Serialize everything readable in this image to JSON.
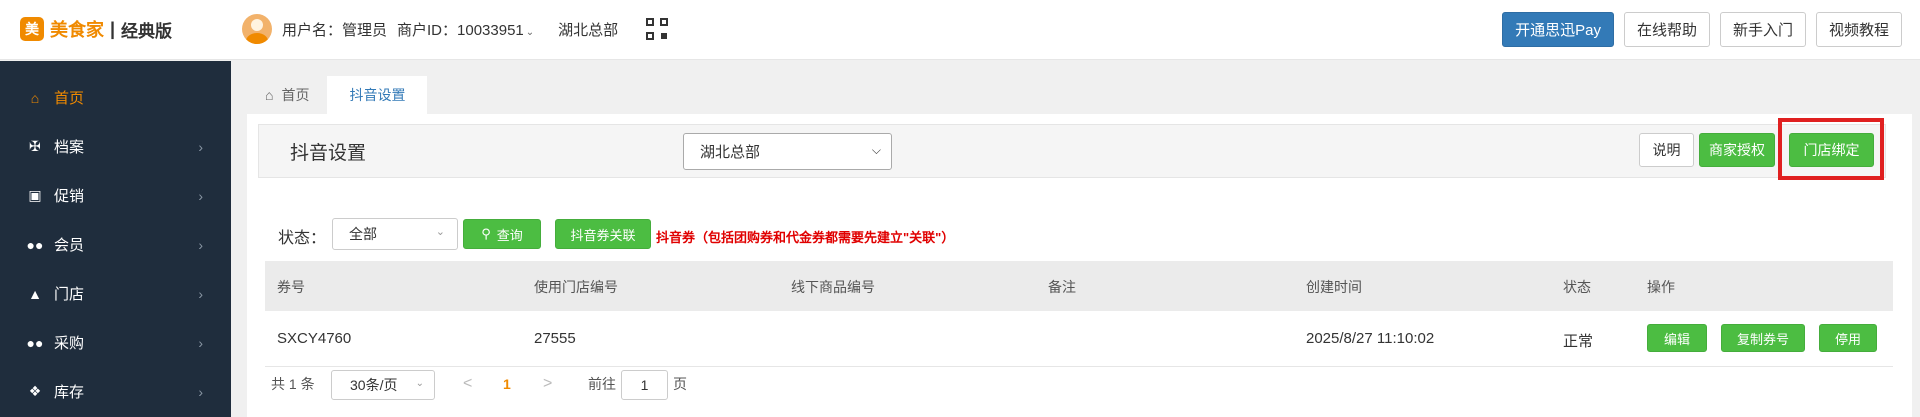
{
  "header": {
    "logo_mark": "美",
    "logo_text": "美食家",
    "logo_sep": "|",
    "edition": "经典版",
    "username_label": "用户名：管理员",
    "merchant_id_label": "商户ID：10033951",
    "store_name": "湖北总部",
    "buttons": {
      "open_pay": "开通思迅Pay",
      "online_help": "在线帮助",
      "beginner": "新手入门",
      "video_tutorial": "视频教程"
    }
  },
  "sidebar": {
    "items": [
      {
        "label": "首页",
        "icon": "home-icon",
        "active": true
      },
      {
        "label": "档案",
        "icon": "cutlery-icon"
      },
      {
        "label": "促销",
        "icon": "gift-icon"
      },
      {
        "label": "会员",
        "icon": "users-icon"
      },
      {
        "label": "门店",
        "icon": "bank-icon"
      },
      {
        "label": "采购",
        "icon": "users-icon"
      },
      {
        "label": "库存",
        "icon": "cubes-icon"
      }
    ]
  },
  "tabs": [
    {
      "label": "首页",
      "icon": "home-icon"
    },
    {
      "label": "抖音设置",
      "active": true
    }
  ],
  "main": {
    "title": "抖音设置",
    "store_select": "湖北总部",
    "buttons": {
      "explain": "说明",
      "merchant_auth": "商家授权",
      "store_bind": "门店绑定"
    }
  },
  "filter": {
    "status_label": "状态：",
    "status_value": "全部",
    "query": "查询",
    "coupon_link": "抖音券关联",
    "note": "抖音券（包括团购券和代金券都需要先建立\"关联\"）"
  },
  "table": {
    "columns": [
      "券号",
      "使用门店编号",
      "线下商品编号",
      "备注",
      "创建时间",
      "状态",
      "操作"
    ],
    "rows": [
      {
        "coupon_no": "SXCY4760",
        "store_no": "27555",
        "offline_goods_no": "",
        "remark": "",
        "created_at": "2025/8/27 11:10:02",
        "status": "正常",
        "actions": [
          "编辑",
          "复制券号",
          "停用"
        ]
      }
    ]
  },
  "pagination": {
    "total": "共 1 条",
    "page_size": "30条/页",
    "prev": "<",
    "current": "1",
    "next": ">",
    "goto_label": "前往",
    "goto_value": "1",
    "page_unit": "页"
  },
  "colors": {
    "accent_orange": "#f08a00",
    "primary_blue": "#337ab7",
    "green": "#4cbd42",
    "sidebar_bg": "#1f2d3d",
    "warning_red": "#e00000",
    "highlight_red": "#e02020"
  }
}
